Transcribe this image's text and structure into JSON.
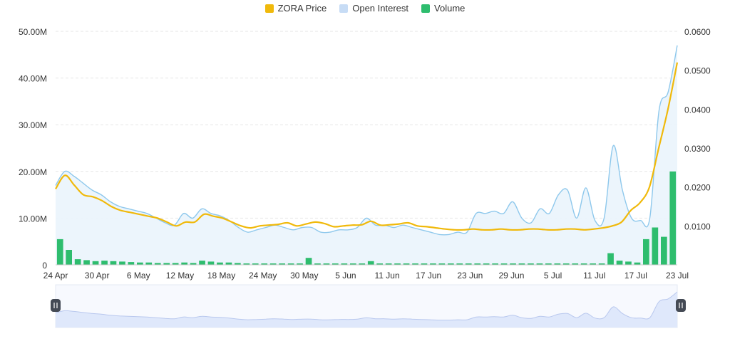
{
  "legend": {
    "price_label": "ZORA Price",
    "oi_label": "Open Interest",
    "volume_label": "Volume"
  },
  "colors": {
    "price": "#f0b90b",
    "oi_line": "#8ec8ec",
    "oi_fill": "#eaf4fc",
    "volume": "#2ebd6e",
    "grid": "#e6e6e6",
    "axis_text": "#333333",
    "slider_fill": "#dfe8fb",
    "slider_line": "#b9c8ee"
  },
  "chart_data": {
    "type": "line",
    "title": "",
    "x_ticks": [
      "24 Apr",
      "30 Apr",
      "6 May",
      "12 May",
      "18 May",
      "24 May",
      "30 May",
      "5 Jun",
      "11 Jun",
      "17 Jun",
      "23 Jun",
      "29 Jun",
      "5 Jul",
      "11 Jul",
      "17 Jul",
      "23 Jul"
    ],
    "y_left": {
      "ticks": [
        "0",
        "10.00M",
        "20.00M",
        "30.00M",
        "40.00M",
        "50.00M"
      ],
      "range": [
        0,
        50000000
      ]
    },
    "y_right": {
      "ticks": [
        "0.0100",
        "0.0200",
        "0.0300",
        "0.0400",
        "0.0500",
        "0.0600"
      ],
      "range": [
        0,
        0.06
      ]
    },
    "grid": true,
    "legend_position": "top-center",
    "series": [
      {
        "name": "ZORA Price",
        "axis": "right",
        "type": "line",
        "values": [
          0.0195,
          0.023,
          0.0205,
          0.018,
          0.0175,
          0.0165,
          0.015,
          0.014,
          0.0135,
          0.013,
          0.0125,
          0.012,
          0.011,
          0.01,
          0.011,
          0.011,
          0.013,
          0.0125,
          0.012,
          0.011,
          0.01,
          0.0095,
          0.01,
          0.0102,
          0.0104,
          0.0108,
          0.01,
          0.0105,
          0.011,
          0.0106,
          0.0098,
          0.01,
          0.0102,
          0.0103,
          0.0112,
          0.0102,
          0.0103,
          0.0105,
          0.0108,
          0.01,
          0.0098,
          0.0095,
          0.0092,
          0.009,
          0.009,
          0.0092,
          0.009,
          0.009,
          0.0092,
          0.009,
          0.009,
          0.0092,
          0.0092,
          0.009,
          0.009,
          0.0092,
          0.0092,
          0.009,
          0.0092,
          0.0095,
          0.01,
          0.011,
          0.014,
          0.016,
          0.02,
          0.03,
          0.04,
          0.052
        ]
      },
      {
        "name": "Open Interest",
        "axis": "left",
        "type": "area",
        "values": [
          17000000,
          20000000,
          19000000,
          17500000,
          16000000,
          15000000,
          13500000,
          12500000,
          12000000,
          11500000,
          11000000,
          10000000,
          9000000,
          8500000,
          11000000,
          10000000,
          12000000,
          11000000,
          10500000,
          9500000,
          8000000,
          7000000,
          7500000,
          8000000,
          8500000,
          8000000,
          7500000,
          8000000,
          8000000,
          7000000,
          7000000,
          7500000,
          7500000,
          8000000,
          10000000,
          8500000,
          8500000,
          8000000,
          8500000,
          8000000,
          7500000,
          7000000,
          6500000,
          6500000,
          7000000,
          7000000,
          11000000,
          11000000,
          11500000,
          11000000,
          13500000,
          10000000,
          9000000,
          12000000,
          11000000,
          15000000,
          16000000,
          10000000,
          16500000,
          9500000,
          10000000,
          25500000,
          16000000,
          10000000,
          9500000,
          10000000,
          33000000,
          37000000,
          47000000
        ]
      },
      {
        "name": "Volume",
        "axis": "left",
        "type": "bar",
        "values": [
          5500000,
          3200000,
          1200000,
          1000000,
          800000,
          900000,
          800000,
          700000,
          600000,
          500000,
          500000,
          400000,
          400000,
          400000,
          500000,
          400000,
          900000,
          700000,
          500000,
          500000,
          400000,
          300000,
          300000,
          300000,
          300000,
          300000,
          300000,
          300000,
          1500000,
          300000,
          300000,
          300000,
          300000,
          300000,
          300000,
          800000,
          300000,
          300000,
          300000,
          300000,
          300000,
          300000,
          300000,
          300000,
          300000,
          300000,
          300000,
          300000,
          300000,
          300000,
          300000,
          300000,
          300000,
          300000,
          300000,
          300000,
          300000,
          300000,
          300000,
          300000,
          300000,
          300000,
          2500000,
          900000,
          700000,
          500000,
          5500000,
          8000000,
          6000000,
          20000000
        ]
      }
    ]
  }
}
